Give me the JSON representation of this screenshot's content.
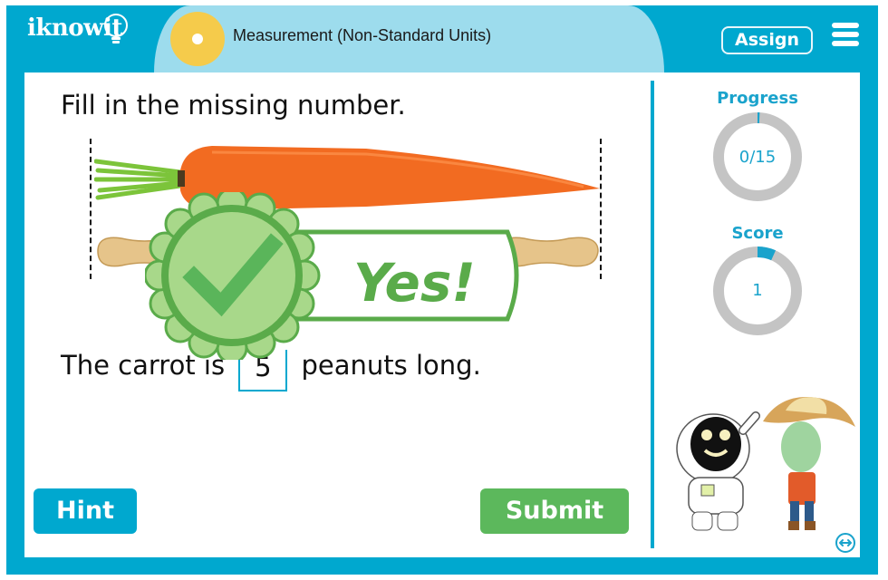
{
  "header": {
    "logo_text": "iknowit",
    "topic_title": "Measurement (Non-Standard Units)",
    "assign_label": "Assign",
    "menu_icon": "hamburger-menu-icon",
    "topic_icon": "yellow-dot-icon"
  },
  "question": {
    "prompt": "Fill in the missing number.",
    "sentence_before": "The carrot is",
    "answer_value": "5",
    "sentence_after": "peanuts long.",
    "object_measured": "carrot",
    "unit_object": "peanut",
    "unit_count": 5
  },
  "feedback": {
    "text": "Yes!",
    "icon": "checkmark-badge-icon",
    "color": "#5aab4a"
  },
  "buttons": {
    "hint_label": "Hint",
    "submit_label": "Submit"
  },
  "sidebar": {
    "progress_label": "Progress",
    "progress_value": "0/15",
    "progress_fraction": 0.0,
    "score_label": "Score",
    "score_value": "1",
    "score_fraction": 0.067
  },
  "colors": {
    "brand_teal": "#00a8cf",
    "topic_pill": "#9ddced",
    "topic_dot": "#f5cb4b",
    "submit_green": "#5cb85c",
    "ring_gray": "#c4c4c4"
  }
}
